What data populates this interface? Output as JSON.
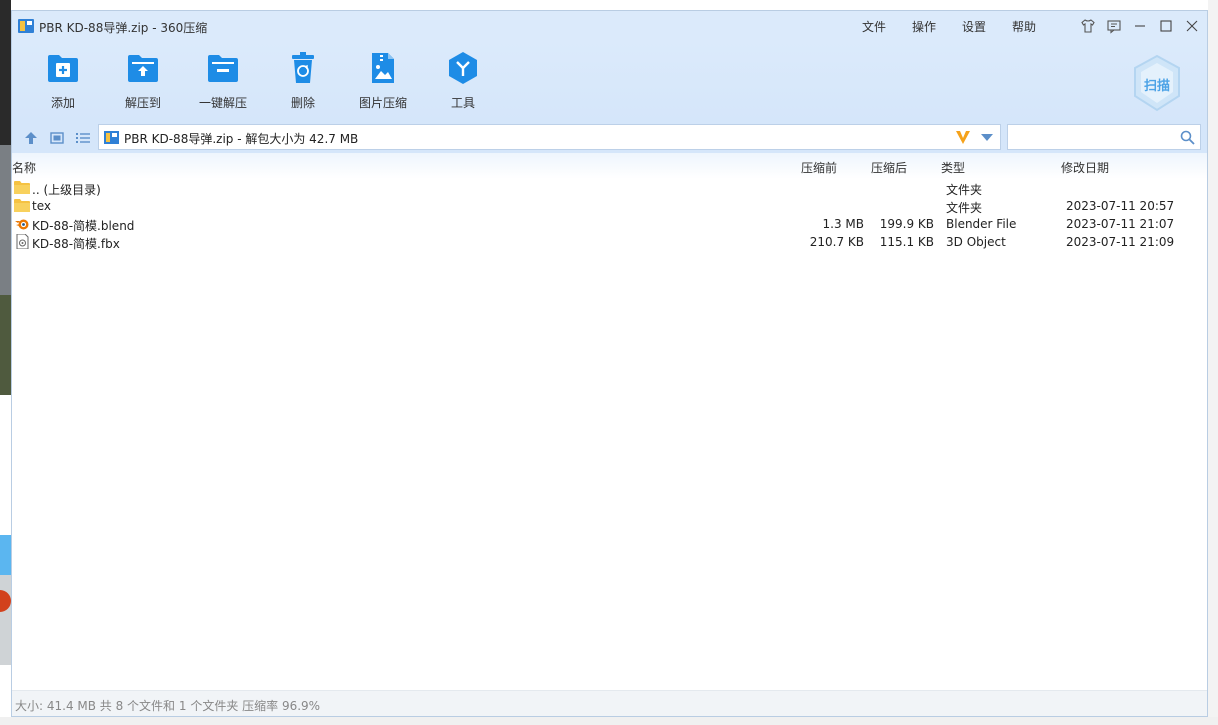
{
  "window": {
    "title": "PBR KD-88导弹.zip - 360压缩",
    "menu": [
      "文件",
      "操作",
      "设置",
      "帮助"
    ]
  },
  "toolbar": {
    "buttons": [
      {
        "label": "添加",
        "icon": "add-icon"
      },
      {
        "label": "解压到",
        "icon": "extract-to-icon"
      },
      {
        "label": "一键解压",
        "icon": "one-click-extract-icon"
      },
      {
        "label": "删除",
        "icon": "delete-icon"
      },
      {
        "label": "图片压缩",
        "icon": "image-compress-icon"
      },
      {
        "label": "工具",
        "icon": "tools-icon"
      }
    ],
    "scan_label": "扫描"
  },
  "navbar": {
    "path": "PBR KD-88导弹.zip - 解包大小为 42.7 MB",
    "search_placeholder": ""
  },
  "columns": {
    "name": "名称",
    "before": "压缩前",
    "after": "压缩后",
    "type": "类型",
    "modified": "修改日期"
  },
  "files": [
    {
      "name": ".. (上级目录)",
      "size": "",
      "packed": "",
      "type": "文件夹",
      "date": "",
      "icon": "folder-icon"
    },
    {
      "name": "tex",
      "size": "",
      "packed": "",
      "type": "文件夹",
      "date": "2023-07-11 20:57",
      "icon": "folder-icon"
    },
    {
      "name": "KD-88-简模.blend",
      "size": "1.3 MB",
      "packed": "199.9 KB",
      "type": "Blender File",
      "date": "2023-07-11 21:07",
      "icon": "blender-file-icon"
    },
    {
      "name": "KD-88-简模.fbx",
      "size": "210.7 KB",
      "packed": "115.1 KB",
      "type": "3D Object",
      "date": "2023-07-11 21:09",
      "icon": "fbx-file-icon"
    }
  ],
  "status": "大小: 41.4 MB 共 8 个文件和 1 个文件夹 压缩率 96.9%",
  "colors": {
    "title_bg": "#dbeafb",
    "accent_blue": "#1e8ce6",
    "folder_yellow": "#f5c242"
  }
}
